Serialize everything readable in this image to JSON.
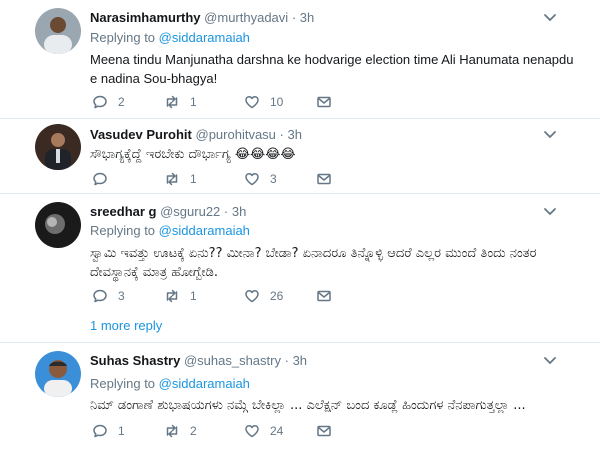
{
  "tweets": [
    {
      "name": "Narasimhamurthy",
      "handle": "@murthyadavi",
      "dot": "·",
      "time": "3h",
      "replying_prefix": "Replying to",
      "replying_to": "@siddaramaiah",
      "text": "Meena tindu Manjunatha darshna ke hodvarige  election time Ali Hanumata nenapdu e nadina Sou-bhagya!",
      "replies": "2",
      "retweets": "1",
      "likes": "10"
    },
    {
      "name": "Vasudev Purohit",
      "handle": "@purohitvasu",
      "dot": "·",
      "time": "3h",
      "text": "ಸೌಭಾಗ್ಯಕ್ಕೆದ್ದೆ ಇರಬೇಕು ದೌರ್ಭಾಗ್ಯ 😂😂😂😂",
      "replies": "",
      "retweets": "1",
      "likes": "3"
    },
    {
      "name": "sreedhar g",
      "handle": "@sguru22",
      "dot": "·",
      "time": "3h",
      "replying_prefix": "Replying to",
      "replying_to": "@siddaramaiah",
      "text": "ಸ್ವಾಮಿ ಇವತ್ತು ಊಟಕ್ಕೆ ಏನು?? ಮೀನಾ? ಬೇಡಾ? ಏನಾದರೂ ತಿನ್ನೊಳ್ಳಿ ಆದರೆ ಎಲ್ಲರ ಮುಂದೆ ತಿಂದು ನಂತರ ದೇವಸ್ಥಾನಕ್ಕೆ ಮಾತ್ರ ಹೋಗ್ಬೇಡಿ.",
      "replies": "3",
      "retweets": "1",
      "likes": "26"
    },
    {
      "name": "Suhas Shastry",
      "handle": "@suhas_shastry",
      "dot": "·",
      "time": "3h",
      "replying_prefix": "Replying to",
      "replying_to": "@siddaramaiah",
      "text": "ನಿಮ್ ಡಂಗಾಣೆ ಶುಭಾಷಯಗಳು ನಮ್ಗೆ ಬೇಕಿಲ್ಲಾ ... ಎಲೆಕ್ಷನ್ ಬಂದ ಕೂಡ್ಲೆ ಹಿಂದುಗಳ ನೆನಪಾಗುತ್ತಲ್ಲಾ ...",
      "replies": "1",
      "retweets": "2",
      "likes": "24"
    }
  ],
  "more_replies": "1 more reply",
  "icons": {
    "reply": "reply-icon",
    "retweet": "retweet-icon",
    "like": "heart-icon",
    "dm": "envelope-icon",
    "caret": "chevron-down-icon"
  },
  "colors": {
    "name": "#14171a",
    "muted": "#657786",
    "link": "#1b95e0",
    "icon": "#657786",
    "separator": "#e1e8ed"
  }
}
